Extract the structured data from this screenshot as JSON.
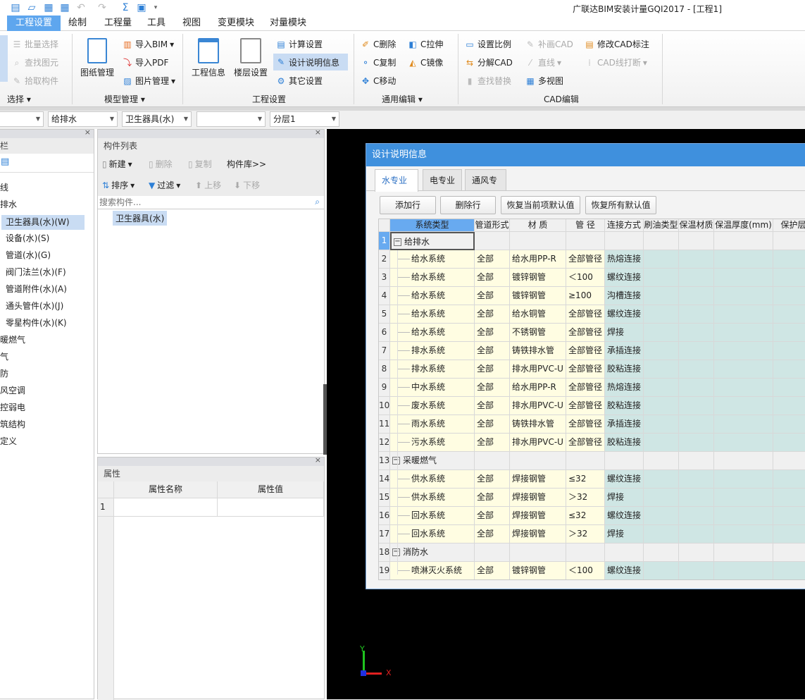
{
  "app": {
    "title": "广联达BIM安装计量GQI2017 - [工程1]"
  },
  "qat": {
    "icons": [
      "new-file-icon",
      "open-folder-icon",
      "gql-export-icon",
      "bim-export-icon",
      "undo-icon",
      "redo-icon",
      "sum-icon",
      "save-icon",
      "customize-icon"
    ],
    "sum_glyph": "Σ"
  },
  "tabs": [
    "工程设置",
    "绘制",
    "工程量",
    "工具",
    "视图",
    "变更模块",
    "对量模块"
  ],
  "ribbon": {
    "select": {
      "items": [
        "批量选择",
        "查找图元",
        "拾取构件"
      ],
      "label": "选择"
    },
    "model": {
      "drawing": "图纸管理",
      "items": [
        "导入BIM",
        "导入PDF",
        "图片管理"
      ],
      "label": "模型管理"
    },
    "project": {
      "info": "工程信息",
      "floor": "楼层设置",
      "items": [
        "计算设置",
        "设计说明信息",
        "其它设置"
      ],
      "label": "工程设置"
    },
    "edit": {
      "items": [
        "C删除",
        "C拉伸",
        "C复制",
        "C镜像",
        "C移动"
      ],
      "label": "通用编辑"
    },
    "cad": {
      "items": [
        "设置比例",
        "补画CAD",
        "修改CAD标注",
        "分解CAD",
        "直线",
        "CAD线打断",
        "查找替换",
        "多视图"
      ],
      "label": "CAD编辑"
    }
  },
  "dropdowns": [
    "",
    "给排水",
    "卫生器具(水)",
    "",
    "分层1"
  ],
  "left_panel": {
    "title": "栏",
    "items": [
      "线",
      "排水",
      "卫生器具(水)(W)",
      "设备(水)(S)",
      "管道(水)(G)",
      "阀门法兰(水)(F)",
      "管道附件(水)(A)",
      "通头管件(水)(J)",
      "零星构件(水)(K)",
      "暖燃气",
      "气",
      "防",
      "风空调",
      "控弱电",
      "筑结构",
      "定义"
    ]
  },
  "component_list": {
    "title": "构件列表",
    "new": "新建",
    "delete": "删除",
    "copy": "复制",
    "library": "构件库>>",
    "sort": "排序",
    "filter": "过滤",
    "up": "上移",
    "down": "下移",
    "search_placeholder": "搜索构件...",
    "items": [
      "卫生器具(水)"
    ]
  },
  "properties": {
    "title": "属性",
    "columns": [
      "属性名称",
      "属性值"
    ],
    "rows": [
      "1"
    ]
  },
  "dialog": {
    "title": "设计说明信息",
    "tabs": [
      "水专业",
      "电专业",
      "通风专业"
    ],
    "buttons": [
      "添加行",
      "删除行",
      "恢复当前项默认值",
      "恢复所有默认值"
    ],
    "columns": [
      "系统类型",
      "管道形式",
      "材  质",
      "管  径",
      "连接方式",
      "刷油类型",
      "保温材质",
      "保温厚度(mm)",
      "保护层材"
    ],
    "rows": [
      {
        "n": "1",
        "group": "给排水"
      },
      {
        "n": "2",
        "sys": "给水系统",
        "form": "全部",
        "mat": "给水用PP-R",
        "dia": "全部管径",
        "conn": "热熔连接"
      },
      {
        "n": "3",
        "sys": "给水系统",
        "form": "全部",
        "mat": "镀锌钢管",
        "dia": "＜100",
        "conn": "螺纹连接"
      },
      {
        "n": "4",
        "sys": "给水系统",
        "form": "全部",
        "mat": "镀锌钢管",
        "dia": "≥100",
        "conn": "沟槽连接"
      },
      {
        "n": "5",
        "sys": "给水系统",
        "form": "全部",
        "mat": "给水铜管",
        "dia": "全部管径",
        "conn": "螺纹连接"
      },
      {
        "n": "6",
        "sys": "给水系统",
        "form": "全部",
        "mat": "不锈钢管",
        "dia": "全部管径",
        "conn": "焊接"
      },
      {
        "n": "7",
        "sys": "排水系统",
        "form": "全部",
        "mat": "铸铁排水管",
        "dia": "全部管径",
        "conn": "承插连接"
      },
      {
        "n": "8",
        "sys": "排水系统",
        "form": "全部",
        "mat": "排水用PVC-U",
        "dia": "全部管径",
        "conn": "胶粘连接"
      },
      {
        "n": "9",
        "sys": "中水系统",
        "form": "全部",
        "mat": "给水用PP-R",
        "dia": "全部管径",
        "conn": "热熔连接"
      },
      {
        "n": "10",
        "sys": "废水系统",
        "form": "全部",
        "mat": "排水用PVC-U",
        "dia": "全部管径",
        "conn": "胶粘连接"
      },
      {
        "n": "11",
        "sys": "雨水系统",
        "form": "全部",
        "mat": "铸铁排水管",
        "dia": "全部管径",
        "conn": "承插连接"
      },
      {
        "n": "12",
        "sys": "污水系统",
        "form": "全部",
        "mat": "排水用PVC-U",
        "dia": "全部管径",
        "conn": "胶粘连接"
      },
      {
        "n": "13",
        "group": "采暖燃气"
      },
      {
        "n": "14",
        "sys": "供水系统",
        "form": "全部",
        "mat": "焊接钢管",
        "dia": "≤32",
        "conn": "螺纹连接"
      },
      {
        "n": "15",
        "sys": "供水系统",
        "form": "全部",
        "mat": "焊接钢管",
        "dia": "＞32",
        "conn": "焊接"
      },
      {
        "n": "16",
        "sys": "回水系统",
        "form": "全部",
        "mat": "焊接钢管",
        "dia": "≤32",
        "conn": "螺纹连接"
      },
      {
        "n": "17",
        "sys": "回水系统",
        "form": "全部",
        "mat": "焊接钢管",
        "dia": "＞32",
        "conn": "焊接"
      },
      {
        "n": "18",
        "group": "消防水"
      },
      {
        "n": "19",
        "sys": "喷淋灭火系统",
        "form": "全部",
        "mat": "镀锌钢管",
        "dia": "＜100",
        "conn": "螺纹连接"
      }
    ]
  },
  "axis": {
    "x": "X",
    "y": "Y"
  },
  "colors": {
    "accent": "#5ea6ee",
    "dialog_title": "#3f90dd",
    "yellow_cell": "#fffde2",
    "teal_cell": "#cfe6e4",
    "selected": "#c9dcf3"
  }
}
